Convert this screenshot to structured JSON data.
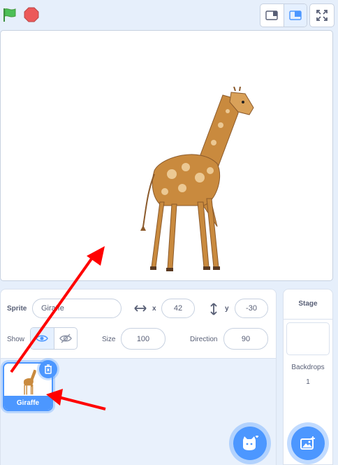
{
  "toolbar": {
    "green_flag_icon": "green-flag-icon",
    "stop_icon": "stop-sign-icon",
    "small_stage_icon": "small-stage-icon",
    "normal_stage_icon": "normal-stage-icon",
    "fullscreen_icon": "fullscreen-icon"
  },
  "stage": {
    "sprite_icon": "giraffe-sprite"
  },
  "sprite_info": {
    "sprite_label": "Sprite",
    "sprite_name": "Giraffe",
    "x_label": "x",
    "x_value": "42",
    "y_label": "y",
    "y_value": "-30",
    "show_label": "Show",
    "size_label": "Size",
    "size_value": "100",
    "direction_label": "Direction",
    "direction_value": "90"
  },
  "sprite_list": {
    "items": [
      {
        "name": "Giraffe",
        "selected": true
      }
    ],
    "add_sprite_icon": "cat-plus-icon"
  },
  "stage_panel": {
    "title": "Stage",
    "backdrops_label": "Backdrops",
    "backdrops_count": "1",
    "add_backdrop_icon": "image-plus-icon"
  },
  "colors": {
    "accent": "#4c97ff",
    "green_flag": "#4cbf56",
    "stop": "#ec5959",
    "annotation_arrow": "#ff0000"
  }
}
